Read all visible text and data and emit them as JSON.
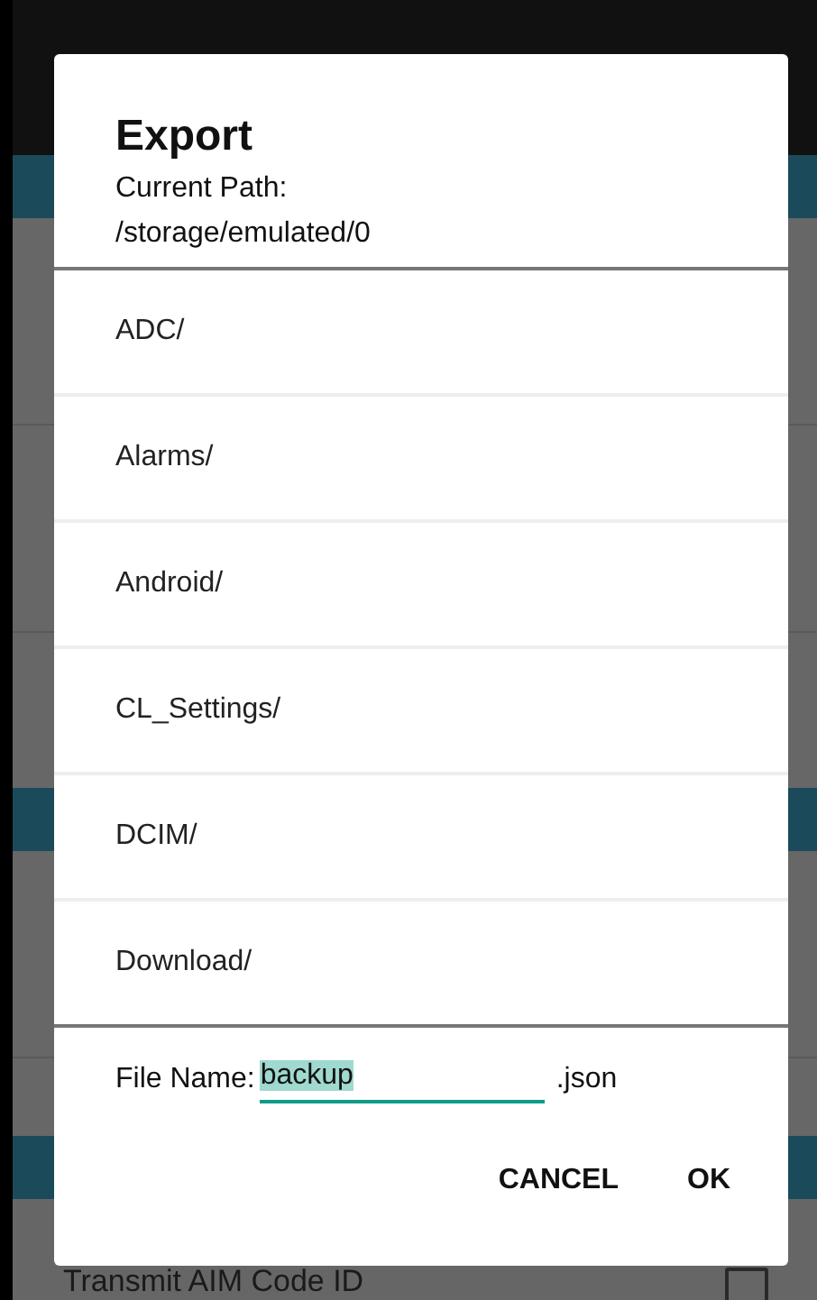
{
  "background": {
    "setting": {
      "label": "Transmit AIM Code ID",
      "checked": false
    }
  },
  "dialog": {
    "title": "Export",
    "path_label": "Current Path:",
    "path": "/storage/emulated/0",
    "folders": [
      "ADC/",
      "Alarms/",
      "Android/",
      "CL_Settings/",
      "DCIM/",
      "Download/"
    ],
    "file_name_label": "File Name:",
    "file_name": "backup",
    "extension": ".json",
    "buttons": [
      "CANCEL",
      "OK"
    ]
  }
}
